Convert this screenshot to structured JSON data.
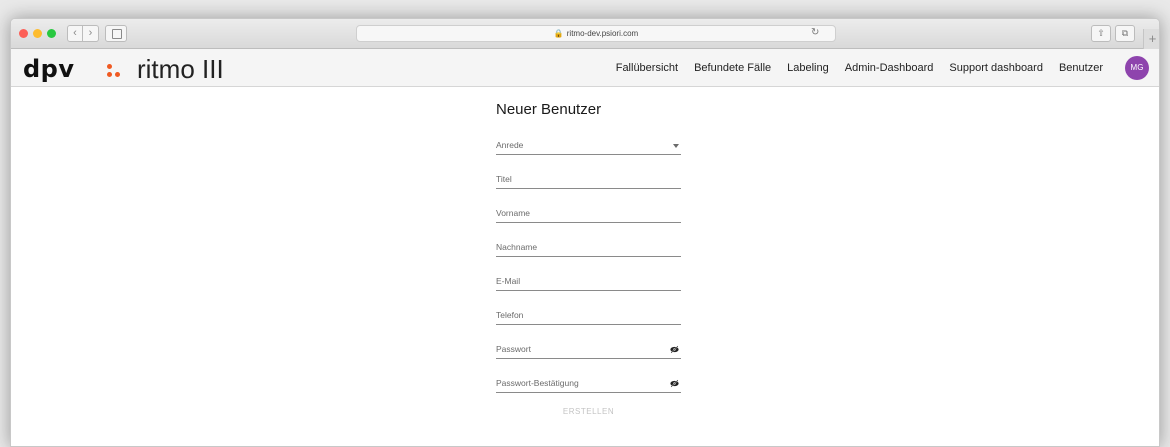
{
  "browser": {
    "url": "ritmo-dev.psiori.com"
  },
  "app": {
    "logo_text": "dpv",
    "name": "ritmo III"
  },
  "nav": {
    "items": [
      {
        "label": "Fallübersicht"
      },
      {
        "label": "Befundete Fälle"
      },
      {
        "label": "Labeling"
      },
      {
        "label": "Admin-Dashboard"
      },
      {
        "label": "Support dashboard"
      },
      {
        "label": "Benutzer"
      }
    ],
    "avatar_initials": "MG",
    "avatar_color": "#8e44ad"
  },
  "form": {
    "title": "Neuer Benutzer",
    "fields": [
      {
        "label": "Anrede",
        "type": "select",
        "value": ""
      },
      {
        "label": "Titel",
        "type": "text",
        "value": ""
      },
      {
        "label": "Vorname",
        "type": "text",
        "value": ""
      },
      {
        "label": "Nachname",
        "type": "text",
        "value": ""
      },
      {
        "label": "E-Mail",
        "type": "email",
        "value": ""
      },
      {
        "label": "Telefon",
        "type": "tel",
        "value": ""
      },
      {
        "label": "Passwort",
        "type": "password",
        "value": "",
        "icon": "eye-off-icon"
      },
      {
        "label": "Passwort-Bestätigung",
        "type": "password",
        "value": "",
        "icon": "eye-off-icon"
      }
    ],
    "submit_label": "ERSTELLEN",
    "submit_enabled": false
  },
  "colors": {
    "brand_dot": "#f05a22",
    "avatar": "#8e44ad"
  }
}
